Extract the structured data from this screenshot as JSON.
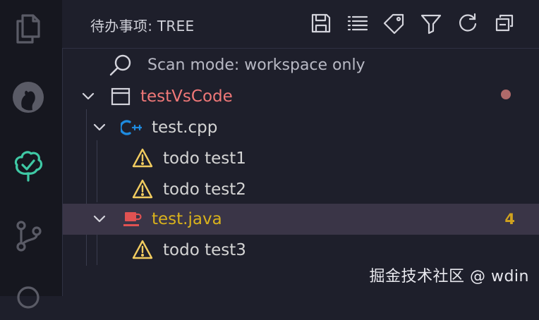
{
  "header": {
    "title": "待办事项: TREE"
  },
  "scan_mode": {
    "text": "Scan mode: workspace only"
  },
  "tree": {
    "workspace": {
      "label": "testVsCode",
      "color": "#f07878"
    },
    "files": [
      {
        "label": "test.cpp",
        "color": "#e8e8ee",
        "items": [
          {
            "label": "todo test1"
          },
          {
            "label": "todo test2"
          }
        ]
      },
      {
        "label": "test.java",
        "color": "#d9b21c",
        "count": "4",
        "items": [
          {
            "label": "todo test3"
          }
        ]
      }
    ]
  },
  "watermark": "掘金技术社区 @ wdin",
  "colors": {
    "warning": "#f2cc60",
    "java": "#e05252",
    "cpp": "#1e8be0",
    "accent_tree": "#3fc9a5"
  }
}
